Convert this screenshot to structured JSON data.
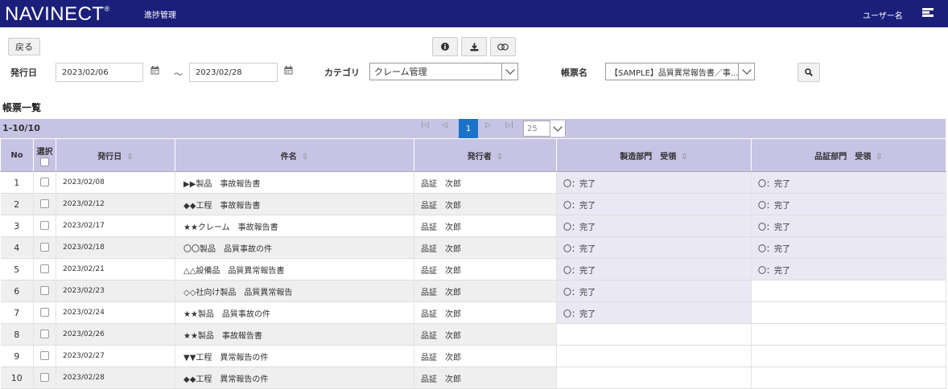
{
  "header": {
    "logo": "NAVINECT",
    "logo_mark": "®",
    "page_title": "進捗管理",
    "username": "ユーザー名",
    "menu_icon": "menu-icon"
  },
  "toolbar": {
    "back_label": "戻る",
    "icons": [
      "info-icon",
      "download-icon",
      "link-icon"
    ]
  },
  "filters": {
    "date_label": "発行日",
    "date_from": "2023/02/06",
    "date_separator": "～",
    "date_to": "2023/02/28",
    "category_label": "カテゴリ",
    "category_value": "クレーム管理",
    "form_label": "帳票名",
    "form_value": "【SAMPLE】品質異常報告書／事..."
  },
  "list": {
    "title": "帳票一覧",
    "count": "1-10/10",
    "current_page": "1",
    "per_page": "25",
    "headers": {
      "no": "No",
      "select": "選択",
      "date": "発行日",
      "subject": "件名",
      "issuer": "発行者",
      "mfg": "製造部門　受領",
      "qa": "品証部門　受領"
    },
    "rows": [
      {
        "no": "1",
        "date": "2023/02/08",
        "subject": "▶▶製品　事故報告書",
        "issuer": "品証　次郎",
        "mfg": "〇：完了",
        "qa": "〇：完了"
      },
      {
        "no": "2",
        "date": "2023/02/12",
        "subject": "◆◆工程　事故報告書",
        "issuer": "品証　次郎",
        "mfg": "〇：完了",
        "qa": "〇：完了"
      },
      {
        "no": "3",
        "date": "2023/02/17",
        "subject": "★★クレーム　事故報告書",
        "issuer": "品証　次郎",
        "mfg": "〇：完了",
        "qa": "〇：完了"
      },
      {
        "no": "4",
        "date": "2023/02/18",
        "subject": "〇〇製品　品質事故の件",
        "issuer": "品証　次郎",
        "mfg": "〇：完了",
        "qa": "〇：完了"
      },
      {
        "no": "5",
        "date": "2023/02/21",
        "subject": "△△設備品　品質異常報告書",
        "issuer": "品証　次郎",
        "mfg": "〇：完了",
        "qa": "〇：完了"
      },
      {
        "no": "6",
        "date": "2023/02/23",
        "subject": "◇◇社向け製品　品質異常報告",
        "issuer": "品証　次郎",
        "mfg": "〇：完了",
        "qa": ""
      },
      {
        "no": "7",
        "date": "2023/02/24",
        "subject": "★★製品　品質事故の件",
        "issuer": "品証　次郎",
        "mfg": "〇：完了",
        "qa": ""
      },
      {
        "no": "8",
        "date": "2023/02/26",
        "subject": "★★製品　事故報告書",
        "issuer": "品証　次郎",
        "mfg": "",
        "qa": ""
      },
      {
        "no": "9",
        "date": "2023/02/27",
        "subject": "▼▼工程　異常報告の件",
        "issuer": "品証　次郎",
        "mfg": "",
        "qa": ""
      },
      {
        "no": "10",
        "date": "2023/02/28",
        "subject": "◆◆工程　異常報告の件",
        "issuer": "品証　次郎",
        "mfg": "",
        "qa": ""
      }
    ]
  },
  "colors": {
    "header_bg": "#1b1f7a",
    "table_header_bg": "#c6c3e4",
    "pager_active": "#1a73c8"
  }
}
